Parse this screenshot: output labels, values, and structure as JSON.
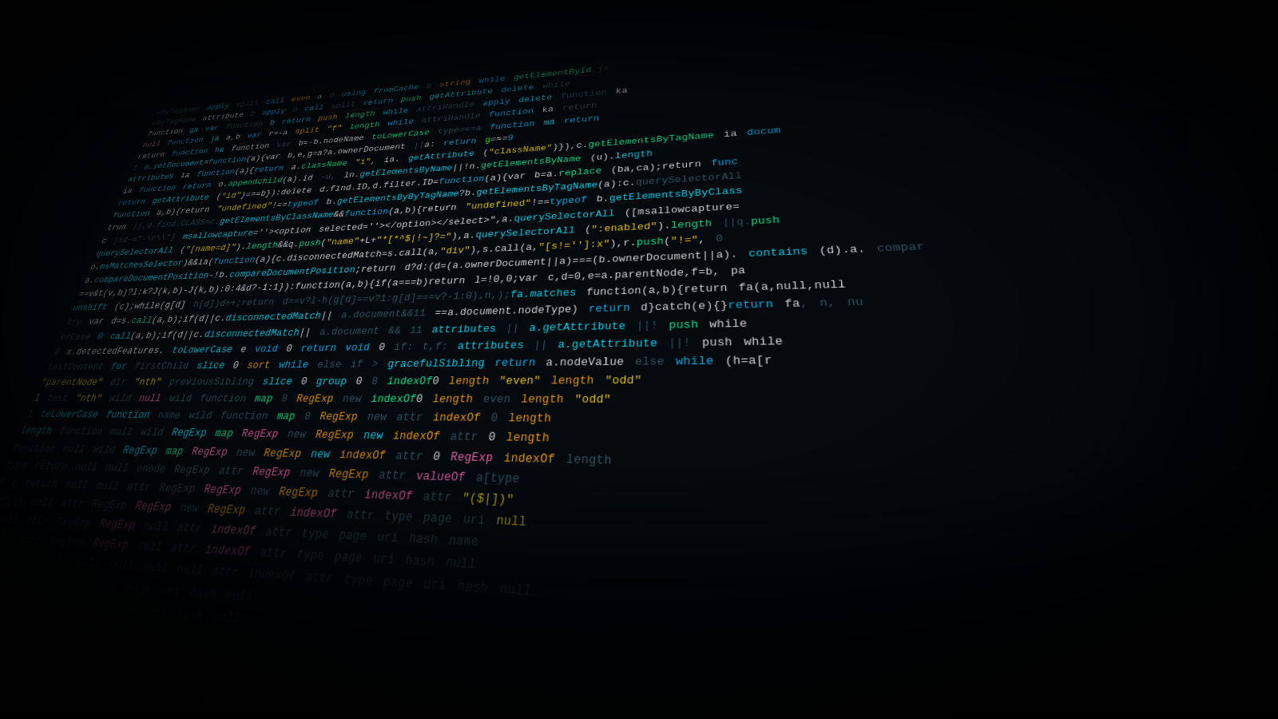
{
  "bg": {
    "description": "Code screenshot background showing minified JavaScript source code",
    "dominant_keyword": "function",
    "colors": {
      "background": "#050a0f",
      "cyan": "#00bfff",
      "teal": "#00fa9a",
      "yellow": "#ffd700",
      "white": "#e8e8e8",
      "pink": "#ff69b4",
      "orange": "#ffa500",
      "purple": "#da70d6",
      "green": "#39ff14"
    }
  },
  "detected_text": {
    "function_word": "function"
  }
}
